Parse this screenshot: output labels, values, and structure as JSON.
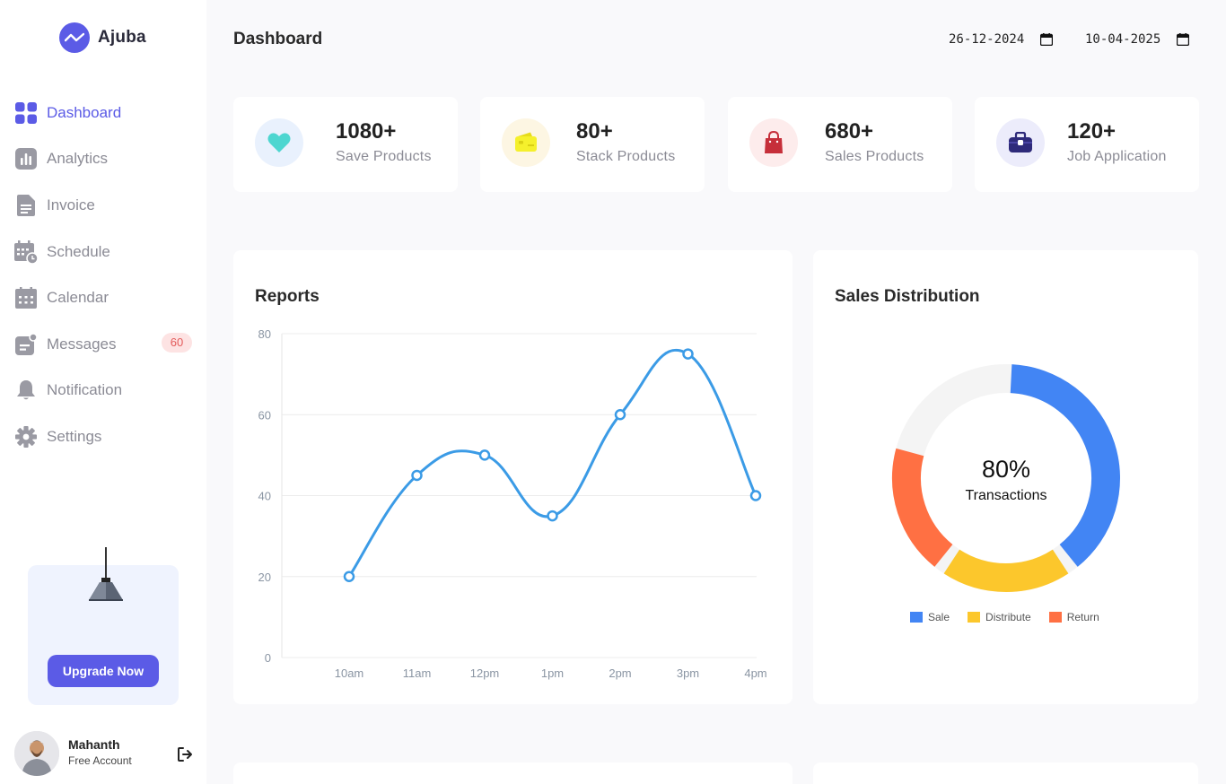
{
  "brand": {
    "name": "Ajuba"
  },
  "sidebar": {
    "items": [
      {
        "label": "Dashboard",
        "icon": "grid-icon",
        "active": true
      },
      {
        "label": "Analytics",
        "icon": "bar-chart-icon"
      },
      {
        "label": "Invoice",
        "icon": "document-icon"
      },
      {
        "label": "Schedule",
        "icon": "calendar-clock-icon"
      },
      {
        "label": "Calendar",
        "icon": "calendar-icon"
      },
      {
        "label": "Messages",
        "icon": "message-icon",
        "badge": "60"
      },
      {
        "label": "Notification",
        "icon": "bell-icon"
      },
      {
        "label": "Settings",
        "icon": "gear-icon"
      }
    ],
    "promo": {
      "button_label": "Upgrade Now"
    },
    "user": {
      "name": "Mahanth",
      "plan": "Free Account"
    }
  },
  "header": {
    "title": "Dashboard",
    "start_date": "26-12-2024",
    "end_date": "10-04-2025"
  },
  "stats": [
    {
      "value": "1080+",
      "label": "Save Products",
      "icon": "heart-icon",
      "bg": "#e9f1fd",
      "color": "#4dd6d0"
    },
    {
      "value": "80+",
      "label": "Stack Products",
      "icon": "wallet-icon",
      "bg": "#fdf6e3",
      "color": "#f5f02c"
    },
    {
      "value": "680+",
      "label": "Sales Products",
      "icon": "shopping-bag-icon",
      "bg": "#fdecec",
      "color": "#c62f3a"
    },
    {
      "value": "120+",
      "label": "Job Application",
      "icon": "briefcase-icon",
      "bg": "#ececfb",
      "color": "#2e2a7a"
    }
  ],
  "reports": {
    "title": "Reports",
    "chart_data": {
      "type": "line",
      "categories": [
        "10am",
        "11am",
        "12pm",
        "1pm",
        "2pm",
        "3pm",
        "4pm"
      ],
      "values": [
        20,
        45,
        50,
        35,
        60,
        75,
        40
      ],
      "yticks": [
        0,
        20,
        40,
        60,
        80
      ],
      "ylim": [
        0,
        80
      ],
      "color": "#3b9be6"
    }
  },
  "sales_distribution": {
    "title": "Sales Distribution",
    "center_value": "80%",
    "center_label": "Transactions",
    "chart_data": {
      "type": "pie",
      "categories": [
        "Sale",
        "Distribute",
        "Return"
      ],
      "values": [
        40,
        20,
        20
      ],
      "colors": [
        "#4285f4",
        "#fcc72c",
        "#ff7043"
      ],
      "track_color": "#f4f4f4"
    }
  }
}
